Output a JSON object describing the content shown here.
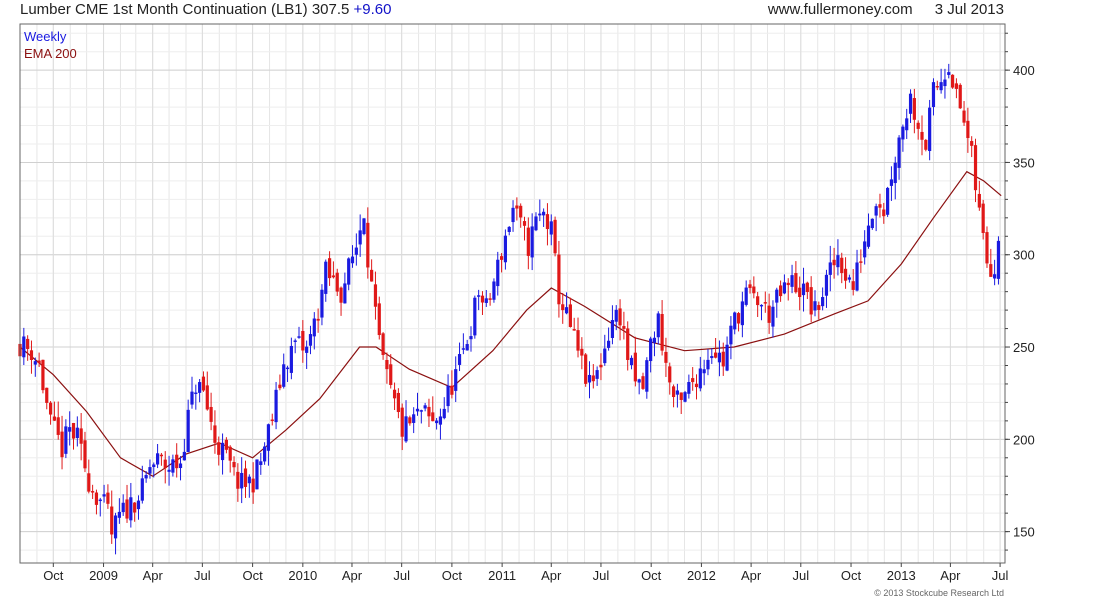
{
  "header": {
    "title": "Lumber CME 1st Month Continuation (LB1)",
    "last": "307.5",
    "change": "+9.60",
    "site": "www.fullermoney.com",
    "date": "3 Jul 2013"
  },
  "copyright": "© 2013 Stockcube Research Ltd",
  "colors": {
    "up": "#1a1ae0",
    "down": "#e01818",
    "ema": "#8b1010",
    "grid": "#d0d0d0",
    "frame": "#666666"
  },
  "chart_data": {
    "type": "candlestick",
    "legend": [
      {
        "label": "Weekly",
        "color": "#1a1ae0"
      },
      {
        "label": "EMA 200",
        "color": "#8b1010"
      }
    ],
    "ylim": [
      133,
      425
    ],
    "y_ticks": [
      150,
      200,
      250,
      300,
      350,
      400
    ],
    "x_range": [
      "2008-08-01",
      "2013-07-10"
    ],
    "x_ticks": [
      {
        "date": "2008-10-01",
        "label": "Oct"
      },
      {
        "date": "2009-01-01",
        "label": "2009"
      },
      {
        "date": "2009-04-01",
        "label": "Apr"
      },
      {
        "date": "2009-07-01",
        "label": "Jul"
      },
      {
        "date": "2009-10-01",
        "label": "Oct"
      },
      {
        "date": "2010-01-01",
        "label": "2010"
      },
      {
        "date": "2010-04-01",
        "label": "Apr"
      },
      {
        "date": "2010-07-01",
        "label": "Jul"
      },
      {
        "date": "2010-10-01",
        "label": "Oct"
      },
      {
        "date": "2011-01-01",
        "label": "2011"
      },
      {
        "date": "2011-04-01",
        "label": "Apr"
      },
      {
        "date": "2011-07-01",
        "label": "Jul"
      },
      {
        "date": "2011-10-01",
        "label": "Oct"
      },
      {
        "date": "2012-01-01",
        "label": "2012"
      },
      {
        "date": "2012-04-01",
        "label": "Apr"
      },
      {
        "date": "2012-07-01",
        "label": "Jul"
      },
      {
        "date": "2012-10-01",
        "label": "Oct"
      },
      {
        "date": "2013-01-01",
        "label": "2013"
      },
      {
        "date": "2013-04-01",
        "label": "Apr"
      },
      {
        "date": "2013-07-01",
        "label": "Jul"
      }
    ],
    "close_path": [
      [
        "2008-08-01",
        252
      ],
      [
        "2008-08-22",
        248
      ],
      [
        "2008-09-05",
        240
      ],
      [
        "2008-09-26",
        208
      ],
      [
        "2008-10-17",
        195
      ],
      [
        "2008-10-31",
        205
      ],
      [
        "2008-11-14",
        200
      ],
      [
        "2008-12-05",
        178
      ],
      [
        "2008-12-19",
        170
      ],
      [
        "2009-01-09",
        160
      ],
      [
        "2009-01-16",
        148
      ],
      [
        "2009-01-30",
        158
      ],
      [
        "2009-02-20",
        165
      ],
      [
        "2009-03-13",
        172
      ],
      [
        "2009-03-27",
        185
      ],
      [
        "2009-04-10",
        188
      ],
      [
        "2009-05-01",
        185
      ],
      [
        "2009-05-22",
        188
      ],
      [
        "2009-06-05",
        212
      ],
      [
        "2009-06-19",
        230
      ],
      [
        "2009-07-03",
        225
      ],
      [
        "2009-07-24",
        200
      ],
      [
        "2009-08-14",
        190
      ],
      [
        "2009-08-28",
        180
      ],
      [
        "2009-09-11",
        175
      ],
      [
        "2009-10-02",
        178
      ],
      [
        "2009-10-16",
        188
      ],
      [
        "2009-11-06",
        212
      ],
      [
        "2009-11-27",
        240
      ],
      [
        "2009-12-18",
        252
      ],
      [
        "2010-01-08",
        248
      ],
      [
        "2010-01-29",
        270
      ],
      [
        "2010-02-12",
        290
      ],
      [
        "2010-02-26",
        285
      ],
      [
        "2010-03-12",
        280
      ],
      [
        "2010-03-26",
        292
      ],
      [
        "2010-04-09",
        305
      ],
      [
        "2010-04-23",
        325
      ],
      [
        "2010-04-30",
        300
      ],
      [
        "2010-05-14",
        265
      ],
      [
        "2010-05-28",
        240
      ],
      [
        "2010-06-18",
        218
      ],
      [
        "2010-07-02",
        205
      ],
      [
        "2010-07-16",
        208
      ],
      [
        "2010-08-06",
        215
      ],
      [
        "2010-08-27",
        208
      ],
      [
        "2010-09-17",
        218
      ],
      [
        "2010-10-01",
        230
      ],
      [
        "2010-10-15",
        240
      ],
      [
        "2010-11-05",
        262
      ],
      [
        "2010-11-19",
        280
      ],
      [
        "2010-12-03",
        270
      ],
      [
        "2010-12-17",
        285
      ],
      [
        "2011-01-07",
        310
      ],
      [
        "2011-01-21",
        325
      ],
      [
        "2011-02-04",
        315
      ],
      [
        "2011-02-18",
        305
      ],
      [
        "2011-03-04",
        318
      ],
      [
        "2011-03-18",
        322
      ],
      [
        "2011-04-01",
        312
      ],
      [
        "2011-04-15",
        278
      ],
      [
        "2011-05-06",
        260
      ],
      [
        "2011-05-27",
        240
      ],
      [
        "2011-06-10",
        228
      ],
      [
        "2011-06-24",
        235
      ],
      [
        "2011-07-08",
        250
      ],
      [
        "2011-07-22",
        265
      ],
      [
        "2011-08-05",
        268
      ],
      [
        "2011-08-19",
        245
      ],
      [
        "2011-09-02",
        230
      ],
      [
        "2011-09-16",
        228
      ],
      [
        "2011-09-30",
        252
      ],
      [
        "2011-10-14",
        265
      ],
      [
        "2011-10-28",
        240
      ],
      [
        "2011-11-11",
        222
      ],
      [
        "2011-11-25",
        218
      ],
      [
        "2011-12-09",
        228
      ],
      [
        "2011-12-30",
        238
      ],
      [
        "2012-01-20",
        250
      ],
      [
        "2012-02-10",
        242
      ],
      [
        "2012-03-02",
        265
      ],
      [
        "2012-03-23",
        278
      ],
      [
        "2012-04-13",
        275
      ],
      [
        "2012-05-04",
        268
      ],
      [
        "2012-05-25",
        278
      ],
      [
        "2012-06-15",
        285
      ],
      [
        "2012-07-06",
        280
      ],
      [
        "2012-07-27",
        268
      ],
      [
        "2012-08-17",
        285
      ],
      [
        "2012-09-07",
        300
      ],
      [
        "2012-09-21",
        290
      ],
      [
        "2012-10-05",
        282
      ],
      [
        "2012-10-19",
        300
      ],
      [
        "2012-11-02",
        318
      ],
      [
        "2012-11-16",
        332
      ],
      [
        "2012-11-30",
        325
      ],
      [
        "2012-12-14",
        345
      ],
      [
        "2013-01-04",
        372
      ],
      [
        "2013-01-18",
        385
      ],
      [
        "2013-02-01",
        372
      ],
      [
        "2013-02-15",
        360
      ],
      [
        "2013-03-01",
        388
      ],
      [
        "2013-03-15",
        395
      ],
      [
        "2013-03-29",
        405
      ],
      [
        "2013-04-12",
        385
      ],
      [
        "2013-04-26",
        372
      ],
      [
        "2013-05-10",
        352
      ],
      [
        "2013-05-24",
        322
      ],
      [
        "2013-06-07",
        298
      ],
      [
        "2013-06-21",
        292
      ],
      [
        "2013-07-03",
        307.5
      ]
    ],
    "ema_path": [
      [
        "2008-08-01",
        250
      ],
      [
        "2008-10-01",
        235
      ],
      [
        "2008-12-01",
        215
      ],
      [
        "2009-02-01",
        190
      ],
      [
        "2009-04-01",
        180
      ],
      [
        "2009-06-01",
        192
      ],
      [
        "2009-08-01",
        198
      ],
      [
        "2009-10-01",
        190
      ],
      [
        "2009-12-01",
        205
      ],
      [
        "2010-02-01",
        222
      ],
      [
        "2010-04-15",
        250
      ],
      [
        "2010-05-15",
        250
      ],
      [
        "2010-07-15",
        238
      ],
      [
        "2010-10-01",
        228
      ],
      [
        "2010-12-15",
        248
      ],
      [
        "2011-02-15",
        270
      ],
      [
        "2011-04-01",
        282
      ],
      [
        "2011-06-01",
        272
      ],
      [
        "2011-09-01",
        255
      ],
      [
        "2011-12-01",
        248
      ],
      [
        "2012-03-01",
        250
      ],
      [
        "2012-06-01",
        257
      ],
      [
        "2012-09-01",
        268
      ],
      [
        "2012-11-01",
        275
      ],
      [
        "2013-01-01",
        295
      ],
      [
        "2013-03-01",
        320
      ],
      [
        "2013-05-01",
        345
      ],
      [
        "2013-06-01",
        340
      ],
      [
        "2013-07-03",
        332
      ]
    ]
  }
}
